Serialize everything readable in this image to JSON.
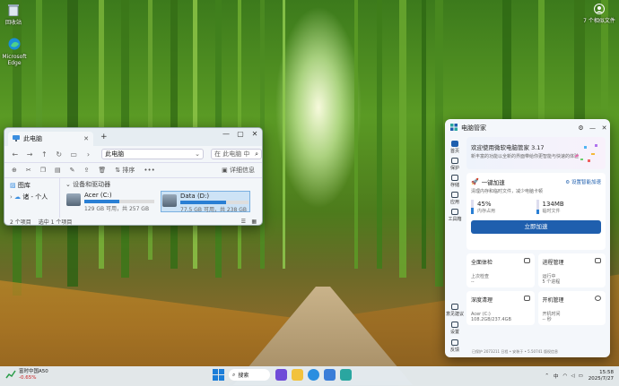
{
  "desktop": {
    "icons": [
      {
        "label": "回收站",
        "icon": "recycle-bin-icon"
      },
      {
        "label": "Microsoft Edge",
        "icon": "edge-icon"
      }
    ],
    "account": {
      "label": "7 个相似文件",
      "icon": "avatar-icon"
    }
  },
  "explorer": {
    "tab_title": "此电脑",
    "window_buttons": [
      "—",
      "▢",
      "✕"
    ],
    "address": "此电脑",
    "search_placeholder": "在 此电脑 中",
    "toolbar": {
      "sort": "排序",
      "more": "•••",
      "details": "详细信息"
    },
    "sidebar": [
      "图库",
      "诸 - 个人"
    ],
    "section": "设备和驱动器",
    "drives": [
      {
        "name": "Acer (C:)",
        "size": "129 GB 可用，共 257 GB",
        "used": 0.5,
        "selected": false
      },
      {
        "name": "Data (D:)",
        "size": "77.5 GB 可用，共 238 GB",
        "used": 0.67,
        "selected": true
      }
    ],
    "status": {
      "count": "2 个项目",
      "selected": "选中 1 个项目"
    }
  },
  "pcm": {
    "title": "电脑管家",
    "controls": [
      "⚙",
      "—",
      "✕"
    ],
    "nav": [
      {
        "label": "首页",
        "active": true
      },
      {
        "label": "保护",
        "active": false
      },
      {
        "label": "存储",
        "active": false
      },
      {
        "label": "应用",
        "active": false
      },
      {
        "label": "工具箱",
        "active": false
      }
    ],
    "nav_bottom": [
      {
        "label": "意见建议"
      },
      {
        "label": "设置"
      },
      {
        "label": "反馈"
      }
    ],
    "welcome": {
      "title": "欢迎使用微软电脑管家 3.17",
      "subtitle": "新丰富的功能以全新的界面带给你更智能与快速的体验"
    },
    "accel": {
      "title": "一键加速",
      "settings": "设置智能加速",
      "desc": "清理内存和临时文件，减少电脑卡顿",
      "memory": {
        "value": "45%",
        "label": "内存占用",
        "fraction": 0.45
      },
      "temp": {
        "value": "134MB",
        "label": "临时文件",
        "fraction": 0.3
      },
      "button": "立即加速"
    },
    "cards": [
      {
        "title": "全面体检",
        "sub1": "上次检查",
        "sub2": "--"
      },
      {
        "title": "进程管理",
        "sub1": "运行中",
        "sub2": "5 个进程"
      },
      {
        "title": "深度清理",
        "sub1": "Acer (C:)",
        "sub2": "108.2GB/237.4GB"
      },
      {
        "title": "开机管理",
        "sub1": "开机时间",
        "sub2": "-- 秒"
      }
    ],
    "footer": "已保护 2073211 日程 • 安装于 • 5.50741 版权信息"
  },
  "taskbar": {
    "weather": {
      "name": "富时中国A50",
      "change": "-0.65%"
    },
    "search": "搜索",
    "time": "15:58",
    "date": "2025/7/27",
    "lang": "中"
  }
}
